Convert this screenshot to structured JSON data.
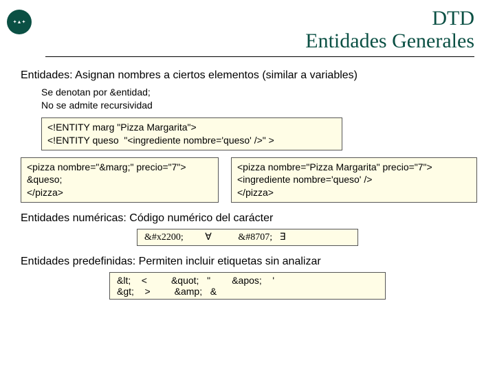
{
  "title_line1": "DTD",
  "title_line2": "Entidades Generales",
  "intro": "Entidades: Asignan nombres a ciertos elementos (similar a variables)",
  "sub1": "Se denotan por &entidad;",
  "sub2": "No se admite recursividad",
  "defbox": "<!ENTITY marg \"Pizza Margarita\">\n<!ENTITY queso  \"<ingrediente nombre='queso' />\" >",
  "leftbox": "<pizza nombre=\"&marg;\" precio=\"7\">\n&queso;\n</pizza>",
  "rightbox": "<pizza nombre=\"Pizza Margarita\" precio=\"7\">\n<ingrediente nombre='queso' />\n</pizza>",
  "numeric_heading": "Entidades numéricas: Código numérico del carácter",
  "numeric_row": "&#x2200;         ∀           &#8707;   ∃",
  "predefined_heading": "Entidades predefinidas: Permiten incluir etiquetas sin analizar",
  "predefined_row": "&lt;    <         &quot;   \"        &apos;    '\n&gt;    >         &amp;   &"
}
